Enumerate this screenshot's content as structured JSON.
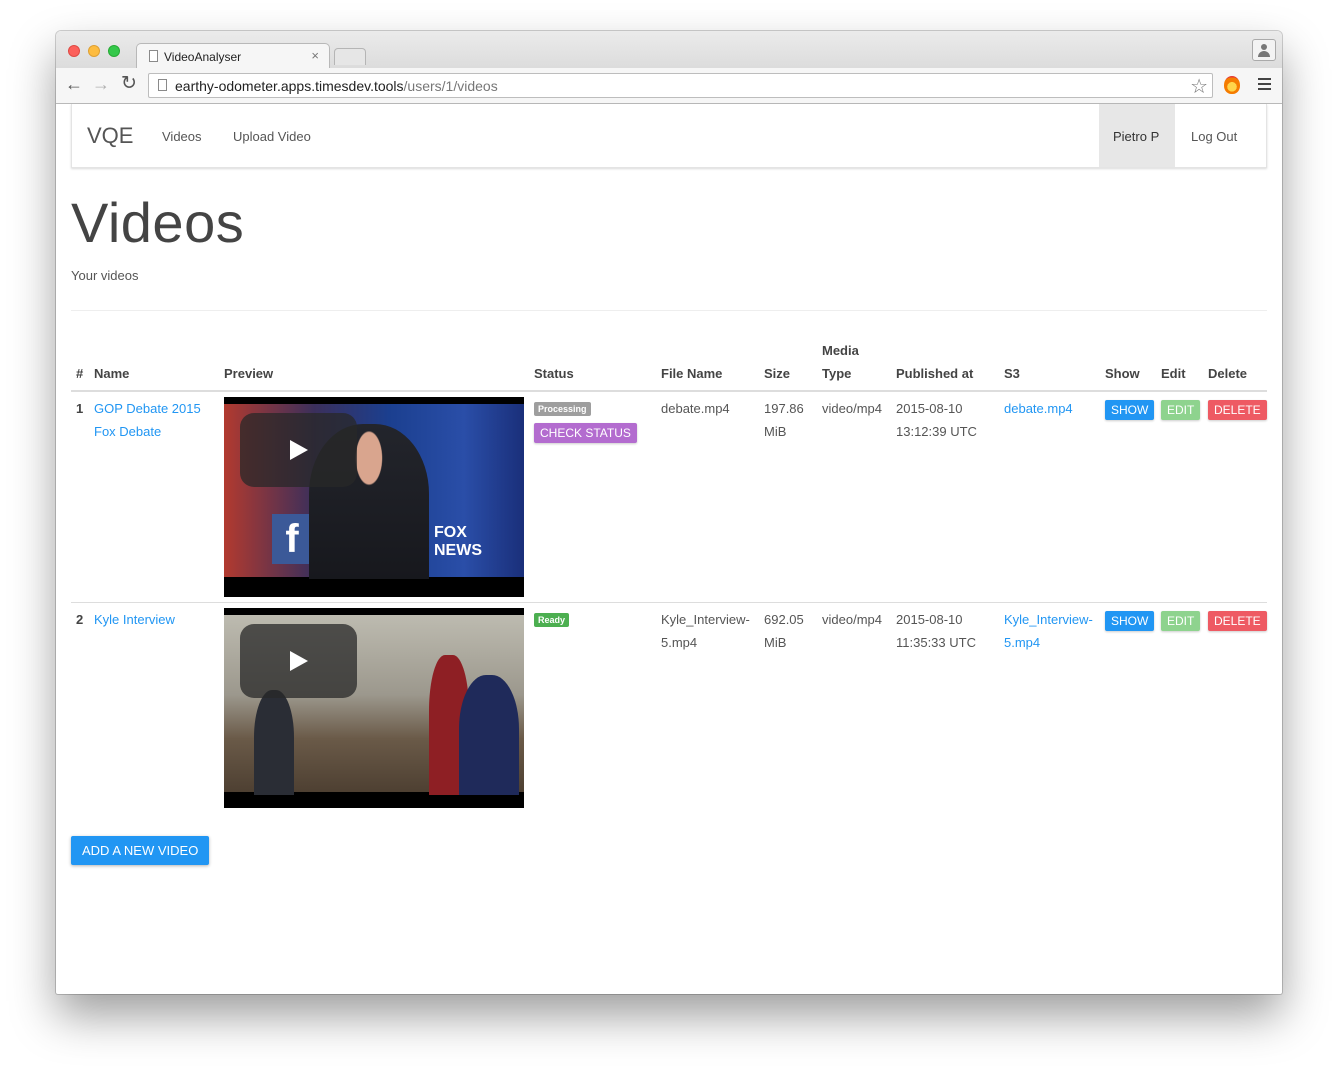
{
  "browser": {
    "tab_title": "VideoAnalyser",
    "tab_close": "×",
    "url_host": "earthy-odometer.apps.timesdev.tools",
    "url_path": "/users/1/videos",
    "back_icon": "←",
    "forward_icon": "→",
    "reload_icon": "↻",
    "star_icon": "☆"
  },
  "navbar": {
    "brand": "VQE",
    "links": [
      "Videos",
      "Upload Video"
    ],
    "user": "Pietro P",
    "logout": "Log Out"
  },
  "page": {
    "title": "Videos",
    "subtitle": "Your videos"
  },
  "table": {
    "headers": {
      "index": "#",
      "name": "Name",
      "preview": "Preview",
      "status": "Status",
      "file_name": "File Name",
      "size": "Size",
      "media_type_1": "Media",
      "media_type_2": "Type",
      "published": "Published at",
      "s3": "S3",
      "show": "Show",
      "edit": "Edit",
      "delete": "Delete"
    },
    "rows": [
      {
        "index": "1",
        "name_1": "GOP Debate 2015",
        "name_2": "Fox Debate",
        "status": "Processing",
        "check_status": "CHECK STATUS",
        "file_name_1": "debate.mp4",
        "file_name_2": "",
        "size_1": "197.86",
        "size_2": "MiB",
        "media_type": "video/mp4",
        "published_1": "2015-08-10",
        "published_2": "13:12:39 UTC",
        "s3_1": "debate.mp4",
        "s3_2": "",
        "show": "SHOW",
        "edit": "EDIT",
        "delete": "DELETE"
      },
      {
        "index": "2",
        "name_1": "Kyle Interview",
        "name_2": "",
        "status": "Ready",
        "file_name_1": "Kyle_Interview-",
        "file_name_2": "5.mp4",
        "size_1": "692.05",
        "size_2": "MiB",
        "media_type": "video/mp4",
        "published_1": "2015-08-10",
        "published_2": "11:35:33 UTC",
        "s3_1": "Kyle_Interview-",
        "s3_2": "5.mp4",
        "show": "SHOW",
        "edit": "EDIT",
        "delete": "DELETE"
      }
    ]
  },
  "actions": {
    "add_video": "ADD A NEW VIDEO"
  },
  "colors": {
    "primary": "#2196f3",
    "success": "#8ed38e",
    "danger": "#ee5a63",
    "purple": "#b36ccf",
    "processing_badge": "#9e9e9e",
    "ready_badge": "#4caf50"
  }
}
